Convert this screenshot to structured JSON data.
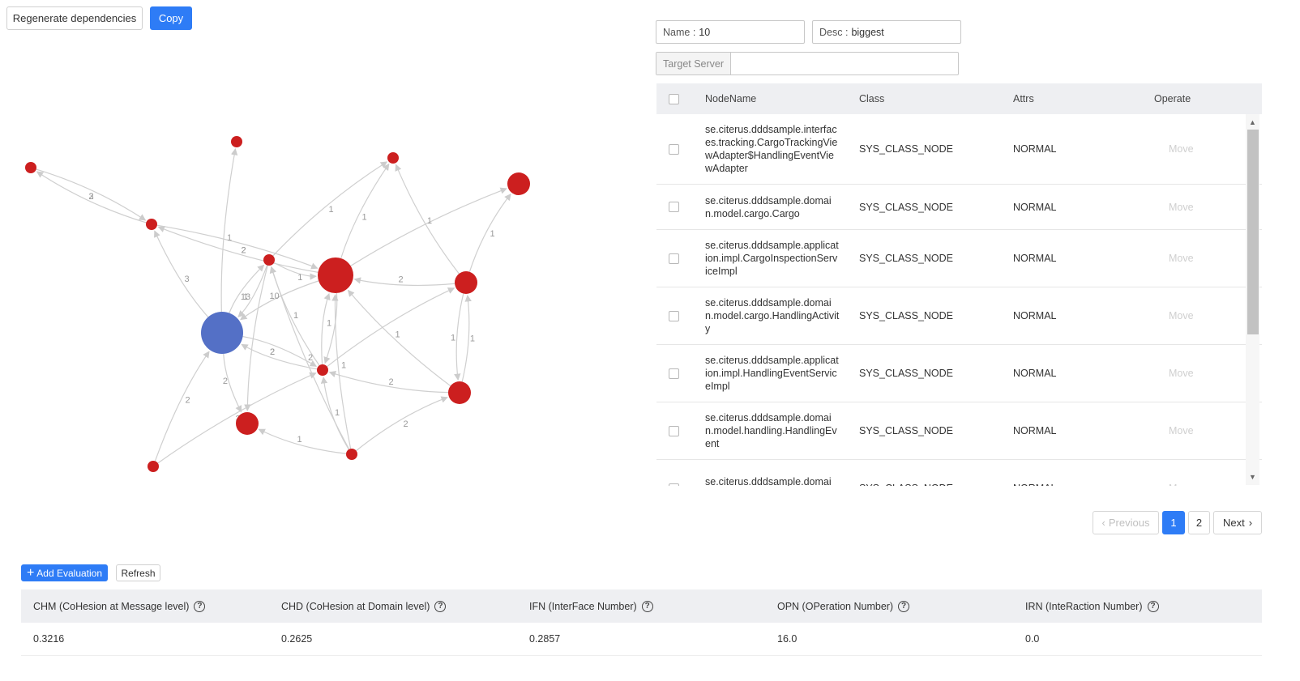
{
  "toolbar": {
    "regenerate_label": "Regenerate dependencies",
    "copy_label": "Copy"
  },
  "form": {
    "name_label": "Name :",
    "name_value": "10",
    "desc_label": "Desc :",
    "desc_value": "biggest",
    "target_label": "Target Server",
    "target_value": ""
  },
  "graph": {
    "colors": {
      "node": "#cc1f1f",
      "selected_node": "#5470c6",
      "edge": "#cfcfcf",
      "edge_label": "#9a9a9a"
    },
    "nodes": [
      {
        "id": "A",
        "color": "red",
        "size": "small"
      },
      {
        "id": "B",
        "color": "red",
        "size": "small"
      },
      {
        "id": "C",
        "color": "red",
        "size": "small"
      },
      {
        "id": "D",
        "color": "red",
        "size": "small"
      },
      {
        "id": "E",
        "color": "red",
        "size": "medium"
      },
      {
        "id": "F",
        "color": "red",
        "size": "small"
      },
      {
        "id": "G",
        "color": "red",
        "size": "large"
      },
      {
        "id": "H",
        "color": "red",
        "size": "medium"
      },
      {
        "id": "I",
        "color": "blue",
        "size": "large"
      },
      {
        "id": "J",
        "color": "red",
        "size": "small"
      },
      {
        "id": "K",
        "color": "red",
        "size": "medium"
      },
      {
        "id": "L",
        "color": "red",
        "size": "medium"
      },
      {
        "id": "M",
        "color": "red",
        "size": "small"
      },
      {
        "id": "N",
        "color": "red",
        "size": "small"
      }
    ],
    "edges": [
      {
        "from": "D",
        "to": "A",
        "label": "2"
      },
      {
        "from": "A",
        "to": "D",
        "label": "3"
      },
      {
        "from": "I",
        "to": "D",
        "label": "3"
      },
      {
        "from": "G",
        "to": "D",
        "label": "2"
      },
      {
        "from": "D",
        "to": "G",
        "label": "2"
      },
      {
        "from": "F",
        "to": "G",
        "label": "1"
      },
      {
        "from": "I",
        "to": "B",
        "label": "1"
      },
      {
        "from": "G",
        "to": "C",
        "label": "1"
      },
      {
        "from": "F",
        "to": "C",
        "label": "1"
      },
      {
        "from": "G",
        "to": "E",
        "label": ""
      },
      {
        "from": "H",
        "to": "G",
        "label": "2"
      },
      {
        "from": "H",
        "to": "C",
        "label": "1"
      },
      {
        "from": "H",
        "to": "E",
        "label": "1"
      },
      {
        "from": "I",
        "to": "F",
        "label": "1"
      },
      {
        "from": "F",
        "to": "I",
        "label": "13"
      },
      {
        "from": "G",
        "to": "I",
        "label": "10"
      },
      {
        "from": "J",
        "to": "F",
        "label": "1"
      },
      {
        "from": "J",
        "to": "I",
        "label": "2"
      },
      {
        "from": "I",
        "to": "J",
        "label": "2"
      },
      {
        "from": "J",
        "to": "G",
        "label": "1"
      },
      {
        "from": "G",
        "to": "J",
        "label": ""
      },
      {
        "from": "K",
        "to": "G",
        "label": "1"
      },
      {
        "from": "K",
        "to": "J",
        "label": "2"
      },
      {
        "from": "H",
        "to": "K",
        "label": "1"
      },
      {
        "from": "K",
        "to": "H",
        "label": "1"
      },
      {
        "from": "J",
        "to": "H",
        "label": ""
      },
      {
        "from": "I",
        "to": "L",
        "label": "2"
      },
      {
        "from": "F",
        "to": "L",
        "label": ""
      },
      {
        "from": "M",
        "to": "I",
        "label": "2"
      },
      {
        "from": "M",
        "to": "J",
        "label": "3"
      },
      {
        "from": "N",
        "to": "L",
        "label": "1"
      },
      {
        "from": "N",
        "to": "J",
        "label": "1"
      },
      {
        "from": "N",
        "to": "F",
        "label": "2"
      },
      {
        "from": "N",
        "to": "K",
        "label": "2"
      },
      {
        "from": "N",
        "to": "G",
        "label": "1"
      }
    ]
  },
  "table": {
    "headers": {
      "node_name": "NodeName",
      "class": "Class",
      "attrs": "Attrs",
      "operate": "Operate"
    },
    "rows": [
      {
        "node_name": "se.citerus.dddsample.interfaces.tracking.CargoTrackingViewAdapter$HandlingEventViewAdapter",
        "class": "SYS_CLASS_NODE",
        "attrs": "NORMAL",
        "operate": "Move"
      },
      {
        "node_name": "se.citerus.dddsample.domain.model.cargo.Cargo",
        "class": "SYS_CLASS_NODE",
        "attrs": "NORMAL",
        "operate": "Move"
      },
      {
        "node_name": "se.citerus.dddsample.application.impl.CargoInspectionServiceImpl",
        "class": "SYS_CLASS_NODE",
        "attrs": "NORMAL",
        "operate": "Move"
      },
      {
        "node_name": "se.citerus.dddsample.domain.model.cargo.HandlingActivity",
        "class": "SYS_CLASS_NODE",
        "attrs": "NORMAL",
        "operate": "Move"
      },
      {
        "node_name": "se.citerus.dddsample.application.impl.HandlingEventServiceImpl",
        "class": "SYS_CLASS_NODE",
        "attrs": "NORMAL",
        "operate": "Move"
      },
      {
        "node_name": "se.citerus.dddsample.domain.model.handling.HandlingEvent",
        "class": "SYS_CLASS_NODE",
        "attrs": "NORMAL",
        "operate": "Move"
      },
      {
        "node_name": "se.citerus.dddsample.domain.model.cargo.RoutingStatus",
        "class": "SYS_CLASS_NODE",
        "attrs": "NORMAL",
        "operate": "Move"
      }
    ]
  },
  "pagination": {
    "previous": "Previous",
    "pages": [
      "1",
      "2"
    ],
    "current": "1",
    "next": "Next"
  },
  "evaluation": {
    "add_label": "Add Evaluation",
    "refresh_label": "Refresh",
    "metrics": [
      {
        "label": "CHM (CoHesion at Message level)",
        "value": "0.3216"
      },
      {
        "label": "CHD (CoHesion at Domain level)",
        "value": "0.2625"
      },
      {
        "label": "IFN (InterFace Number)",
        "value": "0.2857"
      },
      {
        "label": "OPN (OPeration Number)",
        "value": "16.0"
      },
      {
        "label": "IRN (InteRaction Number)",
        "value": "0.0"
      }
    ]
  }
}
